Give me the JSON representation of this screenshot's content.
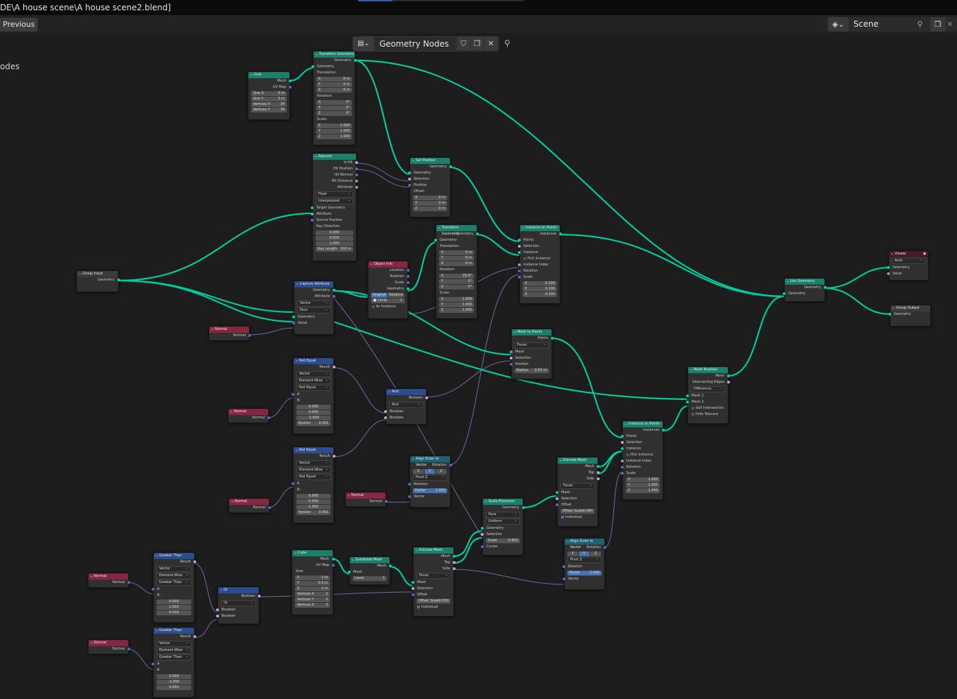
{
  "window": {
    "title": "DE\\A house scene\\A house scene2.blend]"
  },
  "header": {
    "previous_label": "Previous",
    "scene_label": "Scene"
  },
  "editor": {
    "tree_name": "Geometry Nodes",
    "breadcrumb": "odes"
  },
  "nodes": {
    "grid": {
      "title": "Grid",
      "mesh": "Mesh",
      "uvmap": "UV Map",
      "size_x": "Size X",
      "size_x_v": "5 m",
      "size_y": "Size Y",
      "size_y_v": "5 m",
      "vx": "Vertices X",
      "vx_v": "34",
      "vy": "Vertices Y",
      "vy_v": "34"
    },
    "transform1": {
      "title": "Transform Geometry",
      "geometry": "Geometry",
      "translation": "Translation:",
      "rotation": "Rotation:",
      "scale": "Scale:",
      "tx": "0 m",
      "ty": "0 m",
      "tz": "6 m",
      "rx": "0°",
      "ry": "0°",
      "rz": "0°",
      "sx": "1.000",
      "sy": "1.000",
      "sz": "1.000"
    },
    "raycast": {
      "title": "Raycast",
      "is_hit": "Is Hit",
      "hit_pos": "Hit Position",
      "hit_normal": "Hit Normal",
      "hit_dist": "Hit Distance",
      "attribute": "Attribute",
      "mode1": "Float",
      "mode2": "Interpolated",
      "target": "Target Geometry",
      "attribute2": "Attribute",
      "source_pos": "Source Position",
      "ray_dir": "Ray Direction:",
      "d1": "0.000",
      "d2": "0.000",
      "d3": "1.000",
      "ray_len": "Ray Length",
      "ray_len_v": "100 m"
    },
    "setpos": {
      "title": "Set Position",
      "geometry": "Geometry",
      "selection": "Selection",
      "position": "Position",
      "offset": "Offset:",
      "ox": "0 m",
      "oy": "0 m",
      "oz": "0 m"
    },
    "transform2": {
      "title": "Transform Geometry",
      "geometry": "Geometry",
      "translation": "Translation:",
      "rotation": "Rotation:",
      "scale": "Scale:",
      "tx": "0 m",
      "ty": "0 m",
      "tz": "0 m",
      "rx": "25.9°",
      "ry": "0°",
      "rz": "0°",
      "sx": "1.000",
      "sy": "1.000",
      "sz": "1.000"
    },
    "inst1": {
      "title": "Instance on Points",
      "instances": "Instances",
      "points": "Points",
      "selection": "Selection",
      "instance": "Instance",
      "pick": "Pick Instance",
      "index": "Instance Index",
      "rotation": "Rotation",
      "scale": "Scale",
      "sx": "0.100",
      "sy": "0.100",
      "sz": "0.100"
    },
    "groupin": {
      "title": "Group Input",
      "geometry": "Geometry"
    },
    "capture": {
      "title": "Capture Attribute",
      "geometry": "Geometry",
      "attribute": "Attribute",
      "type": "Vector",
      "domain": "Face",
      "geometry_in": "Geometry",
      "value": "Value"
    },
    "objinfo": {
      "title": "Object Info",
      "location": "Location",
      "rotation": "Rotation",
      "scale": "Scale",
      "geometry": "Geometry",
      "original": "Original",
      "relative": "Relative",
      "object": "Circle",
      "as_instance": "As Instance"
    },
    "normal1": {
      "title": "Normal",
      "normal": "Normal"
    },
    "m2p": {
      "title": "Mesh to Points",
      "points": "Points",
      "mode": "Faces",
      "mesh": "Mesh",
      "selection": "Selection",
      "position": "Position",
      "radius": "Radius",
      "radius_v": "0.05 m"
    },
    "notequal1": {
      "title": "Not Equal",
      "result": "Result",
      "type": "Vector",
      "mode": "Element-Wise",
      "op": "Not Equal",
      "a": "A",
      "b": "B:",
      "b1": "0.000",
      "b2": "0.000",
      "b3": "-1.000",
      "eps": "Epsilon",
      "eps_v": "0.001"
    },
    "normal2": {
      "title": "Normal",
      "normal": "Normal"
    },
    "and": {
      "title": "And",
      "boolean": "Boolean",
      "op": "And",
      "in1": "Boolean",
      "in2": "Boolean"
    },
    "notequal2": {
      "title": "Not Equal",
      "result": "Result",
      "type": "Vector",
      "mode": "Element-Wise",
      "op": "Not Equal",
      "a": "A",
      "b": "B:",
      "b1": "0.000",
      "b2": "0.000",
      "b3": "1.000",
      "eps": "Epsilon",
      "eps_v": "0.891"
    },
    "normal3": {
      "title": "Normal",
      "normal": "Normal"
    },
    "align1": {
      "title": "Align Euler to Vector",
      "rotation": "Rotation",
      "x": "X",
      "y": "Y",
      "z": "Z",
      "pivot": "Pivot",
      "pivot_v": "Z",
      "rotation2": "Rotation",
      "factor": "Factor",
      "factor_v": "1.000",
      "vector": "Vector"
    },
    "normal4": {
      "title": "Normal",
      "normal": "Normal"
    },
    "meshbool": {
      "title": "Mesh Boolean",
      "mesh": "Mesh",
      "edges": "Intersecting Edges",
      "op": "Difference",
      "mesh1": "Mesh 1",
      "mesh2": "Mesh 2",
      "self": "Self Intersection",
      "hole": "Hole Tolerant"
    },
    "join": {
      "title": "Join Geometry",
      "geometry": "Geometry",
      "geometry_in": "Geometry"
    },
    "viewer": {
      "title": "Viewer",
      "mode": "Auto",
      "geometry": "Geometry",
      "value": "Value"
    },
    "groupout": {
      "title": "Group Output",
      "geometry": "Geometry"
    },
    "inst2": {
      "title": "Instance on Points",
      "instances": "Instances",
      "points": "Points",
      "selection": "Selection",
      "instance": "Instance",
      "pick": "Pick Instance",
      "index": "Instance Index",
      "rotation": "Rotation",
      "scale": "Scale",
      "sx": "1.000",
      "sy": "1.000",
      "sz": "1.000"
    },
    "extrude1": {
      "title": "Extrude Mesh",
      "mesh": "Mesh",
      "top": "Top",
      "side": "Side",
      "mode": "Faces",
      "mesh_in": "Mesh",
      "selection": "Selection",
      "offset": "Offset",
      "oscale": "Offset Scale",
      "oscale_v": "0.040",
      "individual": "Individual"
    },
    "scale": {
      "title": "Scale Elements",
      "geometry": "Geometry",
      "domain": "Face",
      "mode": "Uniform",
      "geometry_in": "Geometry",
      "selection": "Selection",
      "scale": "Scale",
      "scale_v": "0.800",
      "center": "Center"
    },
    "align2": {
      "title": "Align Euler to Vector",
      "rotation": "Rotation",
      "x": "X",
      "y": "Y",
      "z": "Z",
      "pivot": "Pivot",
      "pivot_v": "Z",
      "rotation2": "Rotation",
      "factor": "Factor",
      "factor_v": "1.000",
      "vector": "Vector"
    },
    "greater1": {
      "title": "Greater Than",
      "result": "Result",
      "type": "Vector",
      "mode": "Element-Wise",
      "op": "Greater Than",
      "a": "A",
      "b": "B:",
      "b1": "0.000",
      "b2": "1.000",
      "b3": "0.000"
    },
    "normal5": {
      "title": "Normal",
      "normal": "Normal"
    },
    "or": {
      "title": "Or",
      "boolean": "Boolean",
      "op": "Or",
      "in1": "Boolean",
      "in2": "Boolean"
    },
    "cube": {
      "title": "Cube",
      "mesh": "Mesh",
      "uvmap": "UV Map",
      "size": "Size:",
      "sx": "1 m",
      "sy": "0.3 m",
      "sz": "1 m",
      "vx": "Vertices X",
      "vx_v": "2",
      "vy": "Vertices Y",
      "vy_v": "2",
      "vz": "Vertices Z",
      "vz_v": "2"
    },
    "subdiv": {
      "title": "Subdivide Mesh",
      "mesh": "Mesh",
      "mesh_in": "Mesh",
      "level": "Level",
      "level_v": "1"
    },
    "extrude2": {
      "title": "Extrude Mesh",
      "mesh": "Mesh",
      "top": "Top",
      "side": "Side",
      "mode": "Faces",
      "mesh_in": "Mesh",
      "selection": "Selection",
      "offset": "Offset",
      "oscale": "Offset Scale",
      "oscale_v": "0.000",
      "individual": "Individual"
    },
    "greater2": {
      "title": "Greater Than",
      "result": "Result",
      "type": "Vector",
      "mode": "Element-Wise",
      "op": "Greater Than",
      "a": "A",
      "b": "B:",
      "b1": "0.000",
      "b2": "-1.000",
      "b3": "0.000"
    },
    "normal6": {
      "title": "Normal",
      "normal": "Normal"
    }
  },
  "colors": {
    "geometry_header": "#1a7f6b",
    "input_header": "#872542",
    "function_header": "#2b4d8d",
    "utility_header": "#1e6173",
    "geometry_wire": "#00d6a3",
    "vector_wire": "#6363c7"
  }
}
